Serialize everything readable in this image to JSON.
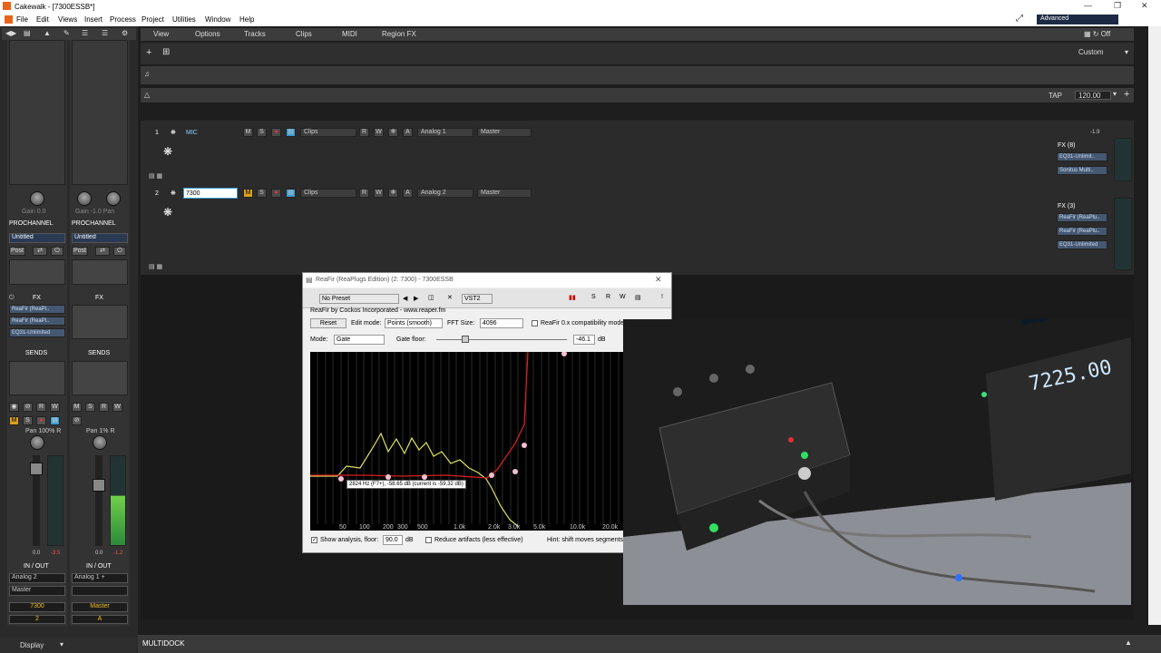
{
  "window": {
    "title": "Cakewalk - [7300ESSB*]"
  },
  "menu": [
    "File",
    "Edit",
    "Views",
    "Insert",
    "Process",
    "Project",
    "Utilities",
    "Window",
    "Help"
  ],
  "menu_right": {
    "mode": "Advanced"
  },
  "toolbar": {
    "items": [
      "View",
      "Options",
      "Tracks",
      "Clips",
      "MIDI",
      "Region FX"
    ],
    "preset": "Custom"
  },
  "transport": {
    "tap": "TAP",
    "tempo": "120.00"
  },
  "tracks": [
    {
      "number": "1",
      "name": "MIC",
      "clips": "Clips",
      "input": "Analog 1",
      "output": "Master",
      "fx_header": "FX (8)",
      "fx": [
        "EQ31-Unlimit..",
        "Sonitus Multi.."
      ],
      "level": "-1.9"
    },
    {
      "number": "2",
      "name": "7300",
      "clips": "Clips",
      "input": "Analog 2",
      "output": "Master",
      "fx_header": "FX (3)",
      "fx": [
        "ReaFir (ReaPlu..",
        "ReaFir (ReaPlu..",
        "EQ31-Unlimited"
      ]
    }
  ],
  "strips": [
    {
      "knob_label": "Gain 0.0",
      "pc": "PROCHANNEL",
      "preset": "Untitled",
      "post": "Post",
      "fx_header": "FX",
      "fx": [
        "ReaFir (ReaPl..",
        "ReaFir (ReaPl..",
        "EQ31-Unlimited"
      ],
      "sends": "SENDS",
      "pan": "Pan 100% R",
      "io": "IN / OUT",
      "input": "Analog 2",
      "output": "Master",
      "name": "7300",
      "num": "2",
      "ticks": [
        "0.0",
        "-3.5"
      ]
    },
    {
      "knob_label": "Gain -1.0  Pan",
      "pc": "PROCHANNEL",
      "preset": "Untitled",
      "post": "Post",
      "fx_header": "FX",
      "fx": [],
      "sends": "SENDS",
      "pan": "Pan 1% R",
      "io": "IN / OUT",
      "input": "Analog 1 +",
      "output": "",
      "name": "Master",
      "num": "A",
      "ticks": [
        "0.0",
        "-1.2"
      ]
    }
  ],
  "display_label": "Display",
  "multidock": "MULTIDOCK",
  "plugin": {
    "title": "ReaFir (ReaPlugs Edition) (2: 7300) - 7300ESSB",
    "preset": "No Preset",
    "plugin_name": "VST2",
    "credit": "ReaFir by Cockos Incorporated - www.reaper.fm",
    "reset": "Reset",
    "edit_mode_label": "Edit mode:",
    "edit_mode": "Points (smooth)",
    "fft_label": "FFT Size:",
    "fft": "4096",
    "compat": "ReaFir 0.x compatibility mode",
    "mode_label": "Mode:",
    "mode": "Gate",
    "gate_floor_label": "Gate floor:",
    "gate_floor": "-46.1",
    "db": "dB",
    "tooltip": "2824 Hz (F7+), -58.65 dB (current is -59.32 dB)",
    "freq_ticks": [
      "50",
      "100",
      "200",
      "300",
      "500",
      "1.0k",
      "2.0k",
      "3.0k",
      "5.0k",
      "10.0k",
      "20.0k"
    ],
    "show_analysis": "Show analysis, floor:",
    "floor": "90.0",
    "floor_unit": "dB",
    "reduce": "Reduce artifacts (less effective)",
    "hint": "Hint: shift moves segments"
  },
  "video": {
    "display": "7225.00"
  }
}
